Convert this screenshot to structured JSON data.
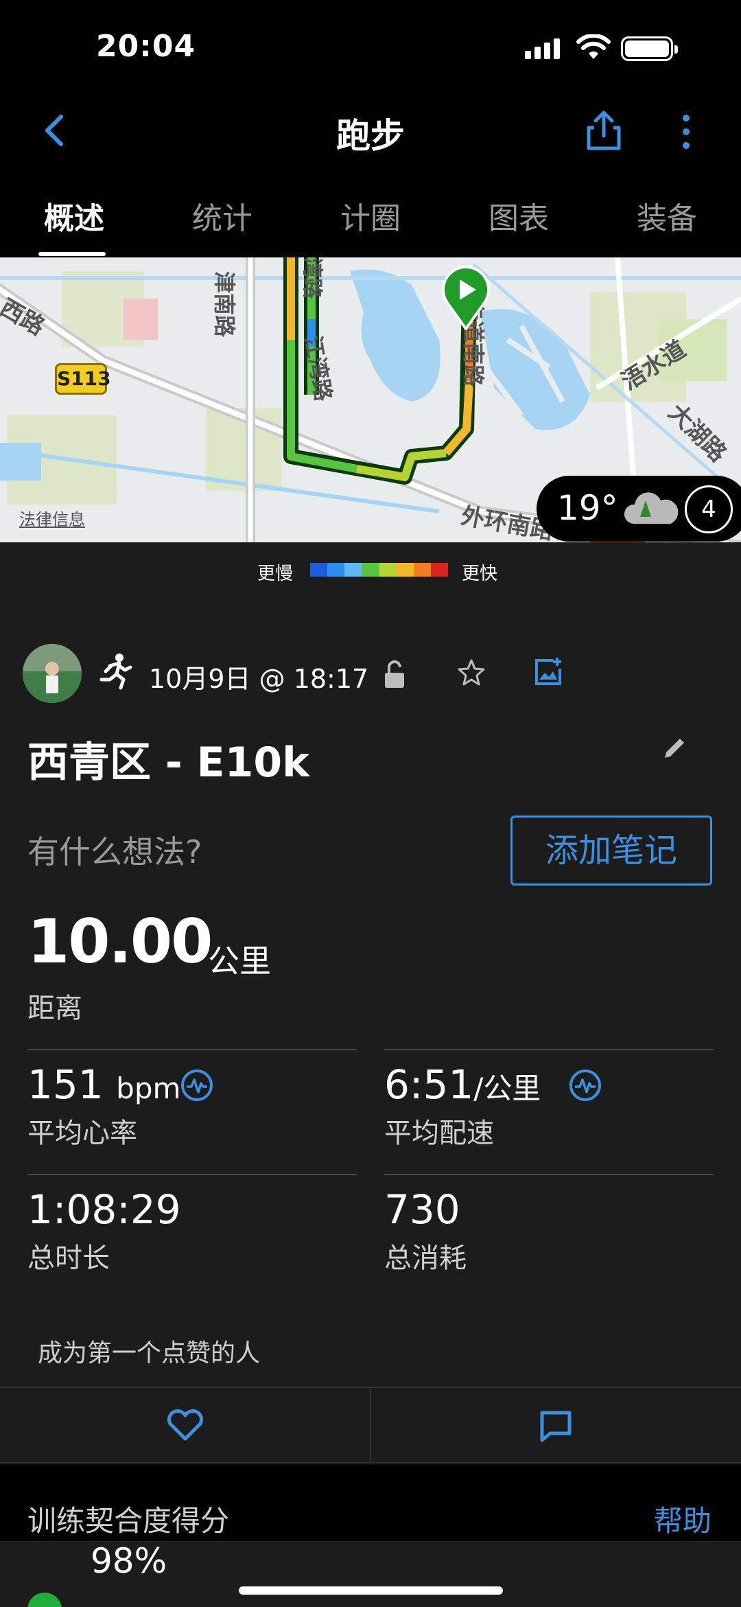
{
  "status_bar": {
    "time": "20:04"
  },
  "header": {
    "title": "跑步"
  },
  "tabs": [
    {
      "label": "概述",
      "active": true
    },
    {
      "label": "统计",
      "active": false
    },
    {
      "label": "计圈",
      "active": false
    },
    {
      "label": "图表",
      "active": false
    },
    {
      "label": "装备",
      "active": false
    }
  ],
  "map": {
    "road_badge": "S113",
    "labels": [
      "津南路",
      "西路",
      "湾路",
      "江湾路",
      "专道南路",
      "浯水道",
      "大湖路",
      "外环南路"
    ],
    "legal": "法律信息",
    "weather": {
      "temp": "19°",
      "wind": "4"
    }
  },
  "legend": {
    "slow": "更慢",
    "fast": "更快",
    "colors": [
      "#1e5bd6",
      "#2e8ef0",
      "#5fb7f5",
      "#59c442",
      "#b6d334",
      "#f2b82c",
      "#f07f1f",
      "#d8261e"
    ]
  },
  "activity": {
    "date": "10月9日 @ 18:17",
    "title": "西青区 - E10k",
    "thoughts_prompt": "有什么想法?",
    "add_note": "添加笔记"
  },
  "stats": {
    "distance": {
      "value": "10.00",
      "unit": "公里",
      "label": "距离"
    },
    "heart_rate": {
      "value": "151",
      "unit": "bpm",
      "label": "平均心率"
    },
    "pace": {
      "value": "6:51",
      "unit": "/公里",
      "label": "平均配速"
    },
    "duration": {
      "value": "1:08:29",
      "label": "总时长"
    },
    "calories": {
      "value": "730",
      "label": "总消耗"
    }
  },
  "social": {
    "like_prompt": "成为第一个点赞的人"
  },
  "training": {
    "title": "训练契合度得分",
    "help": "帮助",
    "score": "98%"
  },
  "colors": {
    "accent": "#3d8fe0",
    "background": "#1c1c1c"
  }
}
